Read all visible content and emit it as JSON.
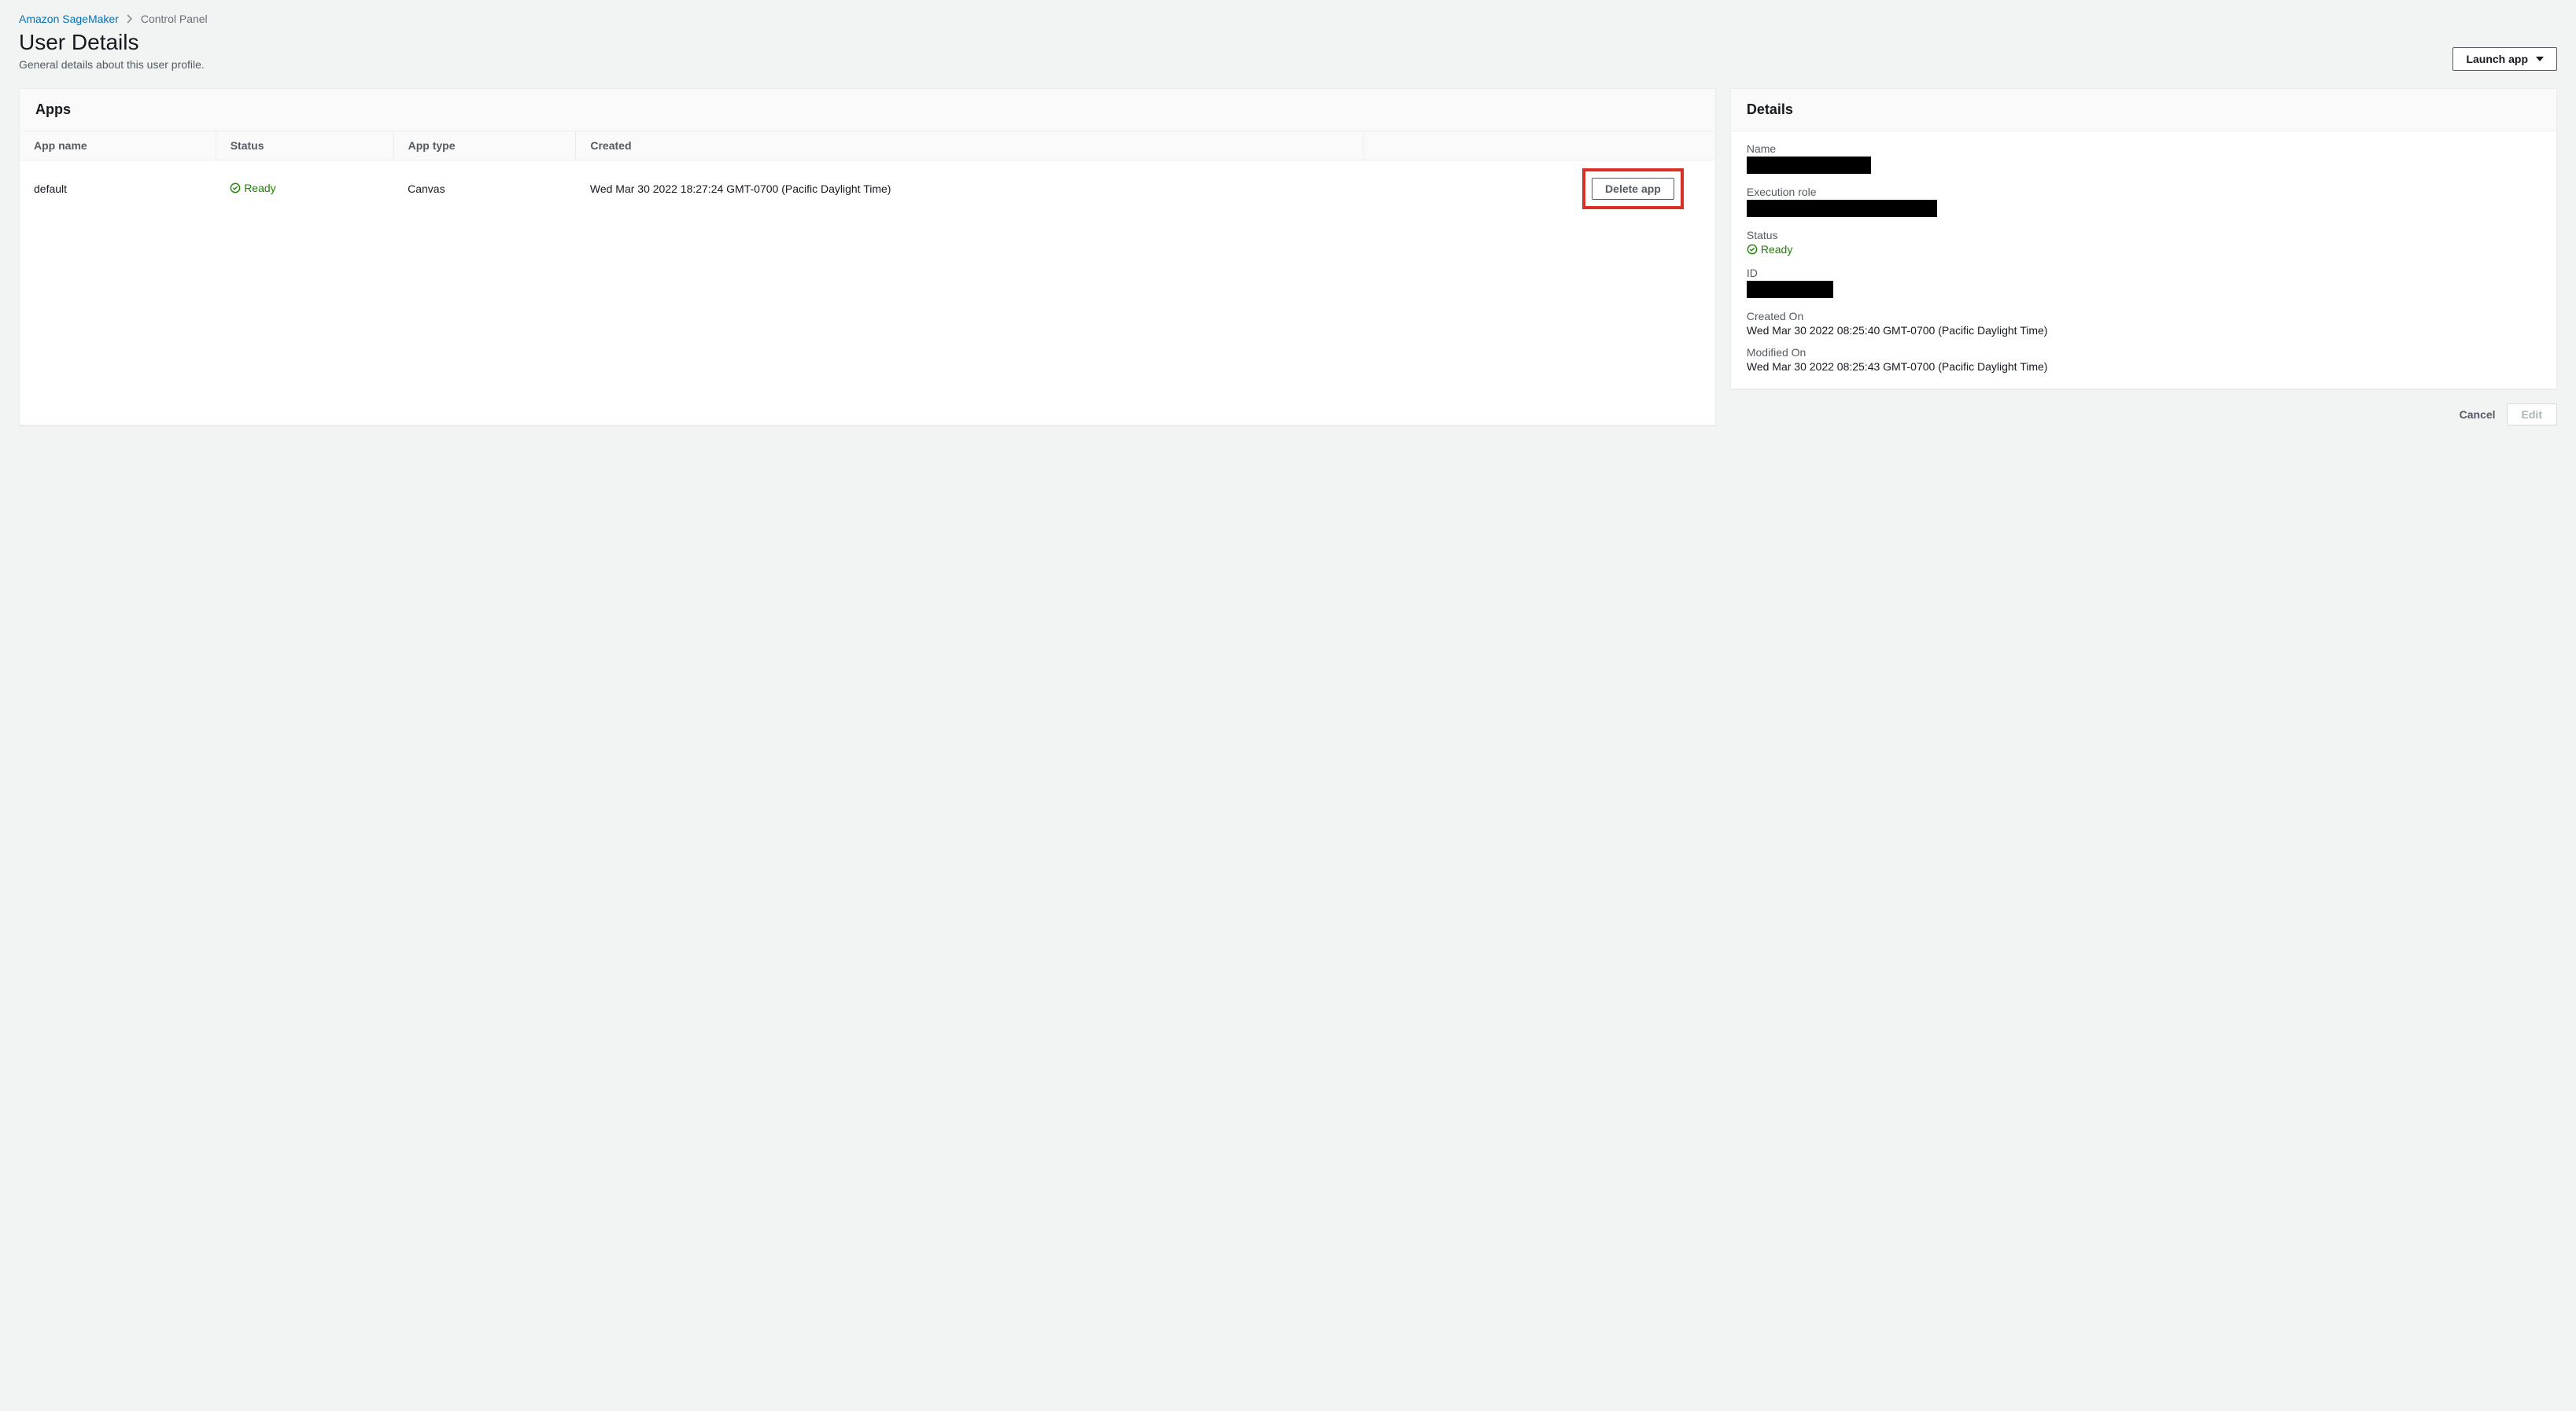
{
  "breadcrumb": {
    "root": "Amazon SageMaker",
    "current": "Control Panel"
  },
  "header": {
    "title": "User Details",
    "subtitle": "General details about this user profile.",
    "launch_label": "Launch app"
  },
  "apps": {
    "panel_title": "Apps",
    "columns": {
      "name": "App name",
      "status": "Status",
      "type": "App type",
      "created": "Created"
    },
    "rows": [
      {
        "name": "default",
        "status": "Ready",
        "type": "Canvas",
        "created": "Wed Mar 30 2022 18:27:24 GMT-0700 (Pacific Daylight Time)",
        "delete_label": "Delete app"
      }
    ]
  },
  "details": {
    "panel_title": "Details",
    "labels": {
      "name": "Name",
      "execution_role": "Execution role",
      "status": "Status",
      "id": "ID",
      "created_on": "Created On",
      "modified_on": "Modified On"
    },
    "status": "Ready",
    "created_on": "Wed Mar 30 2022 08:25:40 GMT-0700 (Pacific Daylight Time)",
    "modified_on": "Wed Mar 30 2022 08:25:43 GMT-0700 (Pacific Daylight Time)"
  },
  "footer": {
    "cancel": "Cancel",
    "edit": "Edit"
  }
}
